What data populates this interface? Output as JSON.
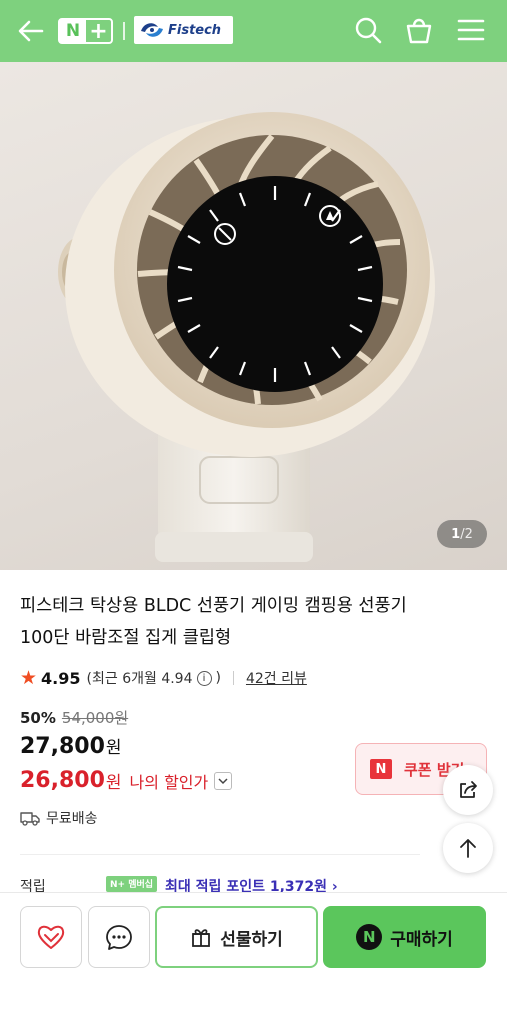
{
  "header": {
    "back_icon": "arrow-left-icon",
    "nplus_letter": "N",
    "nplus_plus": "+",
    "brand": "Fistech",
    "icons": [
      "search-icon",
      "shopping-basket-icon",
      "menu-icon"
    ],
    "bg_color": "#7ed17e"
  },
  "gallery": {
    "current": "1",
    "separator": "/",
    "total": "2"
  },
  "product": {
    "title_line1": "피스테크 탁상용 BLDC 선풍기 게이밍 캠핑용 선풍기",
    "title_line2": "100단 바람조절 집게 클립형",
    "rating": "4.95",
    "recent_text": "(최근 6개월 4.94",
    "recent_close": ")",
    "review_count": "42건 리뷰"
  },
  "price": {
    "discount_pct": "50%",
    "original": "54,000원",
    "sale_amount": "27,800",
    "won": "원",
    "my_price_amount": "26,800",
    "my_discount_label": "나의 할인가",
    "accent_color": "#d9212b"
  },
  "coupon": {
    "badge": "N",
    "label": "쿠폰 받기"
  },
  "shipping": {
    "label": "무료배송"
  },
  "points": {
    "label": "적립",
    "badge": "N+ 멤버십",
    "text": "최대 적립 포인트 1,372원 ›"
  },
  "actions": {
    "gift_label": "선물하기",
    "buy_badge": "N",
    "buy_label": "구매하기",
    "buy_color": "#5bc65c"
  }
}
